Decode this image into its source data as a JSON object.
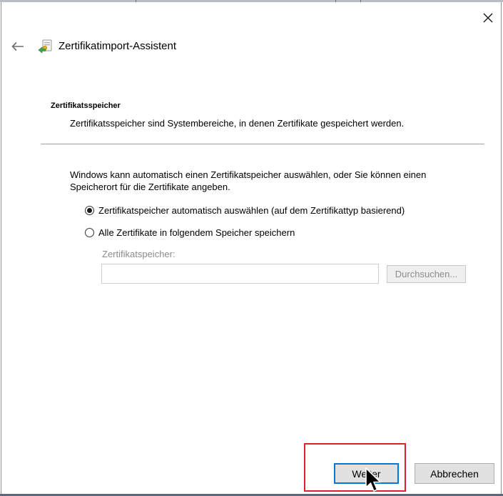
{
  "window": {
    "title": "Zertifikatimport-Assistent",
    "close_glyph": "✕"
  },
  "page": {
    "section_title": "Zertifikatsspeicher",
    "section_description": "Zertifikatsspeicher sind Systembereiche, in denen Zertifikate gespeichert werden.",
    "intro": "Windows kann automatisch einen Zertifikatspeicher auswählen, oder Sie können einen Speicherort für die Zertifikate angeben."
  },
  "options": {
    "auto_label": "Zertifikatspeicher automatisch auswählen (auf dem Zertifikattyp basierend)",
    "auto_selected": true,
    "manual_label": "Alle Zertifikate in folgendem Speicher speichern",
    "manual_selected": false
  },
  "store": {
    "label": "Zertifikatspeicher:",
    "value": "",
    "browse_label": "Durchsuchen..."
  },
  "footer": {
    "next_label": "Weiter",
    "cancel_label": "Abbrechen"
  },
  "icons": {
    "close": "close-icon",
    "back": "back-arrow-icon",
    "wizard": "certificate-icon",
    "cursor": "mouse-pointer-icon"
  },
  "colors": {
    "focus_border": "#0078d7",
    "highlight": "#e0202a",
    "disabled_text": "#8c8c8c"
  }
}
